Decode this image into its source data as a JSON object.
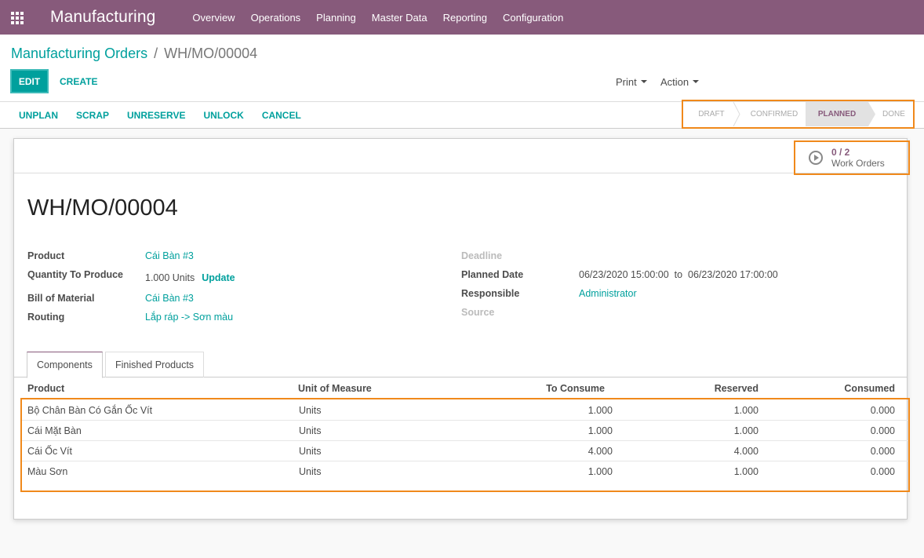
{
  "navbar": {
    "app_name": "Manufacturing",
    "menu": [
      "Overview",
      "Operations",
      "Planning",
      "Master Data",
      "Reporting",
      "Configuration"
    ]
  },
  "breadcrumb": {
    "parent": "Manufacturing Orders",
    "separator": "/",
    "current": "WH/MO/00004"
  },
  "toolbar": {
    "edit_label": "EDIT",
    "create_label": "CREATE",
    "print_label": "Print",
    "action_label": "Action"
  },
  "header_actions": [
    "UNPLAN",
    "SCRAP",
    "UNRESERVE",
    "UNLOCK",
    "CANCEL"
  ],
  "stages": {
    "items": [
      "DRAFT",
      "CONFIRMED",
      "PLANNED",
      "DONE"
    ],
    "active": "PLANNED"
  },
  "work_orders": {
    "count": "0 / 2",
    "label": "Work Orders"
  },
  "record": {
    "title": "WH/MO/00004"
  },
  "fields_left": {
    "product_label": "Product",
    "product_value": "Cái Bàn #3",
    "qty_label": "Quantity To Produce",
    "qty_value": "1.000 Units",
    "update_label": "Update",
    "bom_label": "Bill of Material",
    "bom_value": "Cái Bàn #3",
    "routing_label": "Routing",
    "routing_value": "Lắp ráp -> Sơn màu"
  },
  "fields_right": {
    "deadline_label": "Deadline",
    "planned_label": "Planned Date",
    "planned_from": "06/23/2020 15:00:00",
    "planned_to_word": "to",
    "planned_to": "06/23/2020 17:00:00",
    "responsible_label": "Responsible",
    "responsible_value": "Administrator",
    "source_label": "Source"
  },
  "tabs": [
    "Components",
    "Finished Products"
  ],
  "components": {
    "columns": [
      "Product",
      "Unit of Measure",
      "To Consume",
      "Reserved",
      "Consumed"
    ],
    "rows": [
      [
        "Bộ Chân Bàn Có Gắn Ốc Vít",
        "Units",
        "1.000",
        "1.000",
        "0.000"
      ],
      [
        "Cái Mặt Bàn",
        "Units",
        "1.000",
        "1.000",
        "0.000"
      ],
      [
        "Cái Ốc Vít",
        "Units",
        "4.000",
        "4.000",
        "0.000"
      ],
      [
        "Màu Sơn",
        "Units",
        "1.000",
        "1.000",
        "0.000"
      ]
    ]
  },
  "colors": {
    "brand": "#875a7b",
    "accent": "#00a09d",
    "highlight": "#f0891b"
  }
}
